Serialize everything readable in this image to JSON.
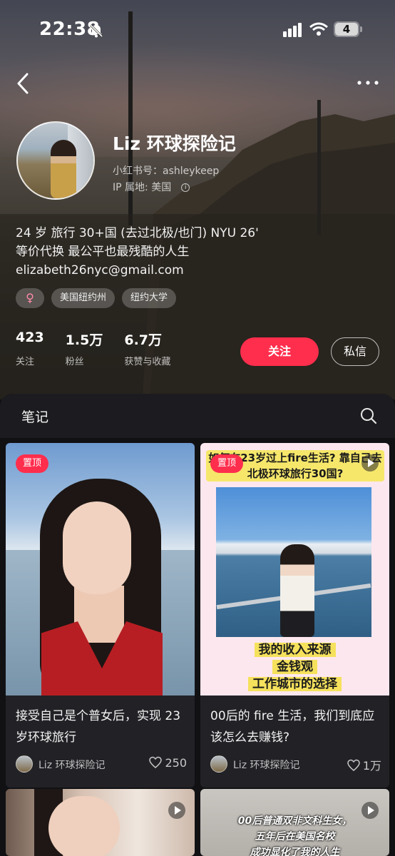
{
  "status": {
    "time": "22:38",
    "battery": "4"
  },
  "profile": {
    "name": "Liz 环球探险记",
    "redbook_id": "小红书号：ashleykeep",
    "ip_location": "IP 属地: 美国",
    "bio": [
      "24 岁 旅行 30+国 (去过北极/也门) NYU 26'",
      "等价代换 最公平也最残酷的人生",
      "elizabeth26nyc@gmail.com"
    ],
    "tags": [
      "♀",
      "美国纽约州",
      "纽约大学"
    ]
  },
  "stats": [
    {
      "value": "423",
      "label": "关注"
    },
    {
      "value": "1.5万",
      "label": "粉丝"
    },
    {
      "value": "6.7万",
      "label": "获赞与收藏"
    }
  ],
  "actions": {
    "follow": "关注",
    "message": "私信"
  },
  "notes": {
    "title": "笔记",
    "cards": [
      {
        "pinned": "置顶",
        "title": "接受自己是个普女后，实现 23 岁环球旅行",
        "author": "Liz 环球探险记",
        "likes": "250"
      },
      {
        "pinned": "置顶",
        "title": "00后的 fire 生活，我们到底应该怎么去赚钱?",
        "author": "Liz 环球探险记",
        "likes": "1万",
        "cover_top": "如何在23岁过上fire生活? 靠自己去北极环球旅行30国?",
        "cover_bottom": [
          "我的收入来源",
          "金钱观",
          "工作城市的选择"
        ]
      },
      {
        "title": ""
      },
      {
        "cover_text": [
          "00后普通双非文科生女，",
          "五年后在美国名校",
          "成功显化了我的人生"
        ]
      }
    ]
  },
  "colors": {
    "accent": "#ff2e4d",
    "background": "#111114"
  }
}
